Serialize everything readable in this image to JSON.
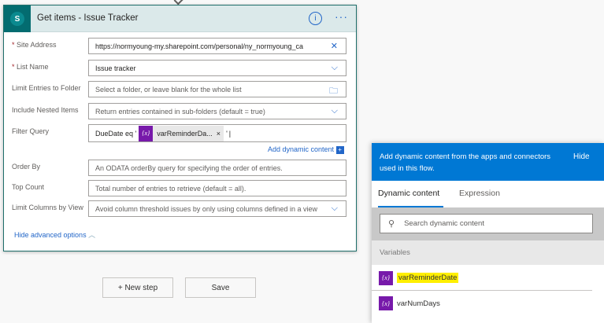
{
  "action": {
    "title": "Get items - Issue Tracker",
    "logo_letter": "S"
  },
  "fields": {
    "site_address": {
      "label": "Site Address",
      "value": "https://normyoung-my.sharepoint.com/personal/ny_normyoung_ca"
    },
    "list_name": {
      "label": "List Name",
      "value": "Issue tracker"
    },
    "folder": {
      "label": "Limit Entries to Folder",
      "placeholder": "Select a folder, or leave blank for the whole list"
    },
    "nested": {
      "label": "Include Nested Items",
      "placeholder": "Return entries contained in sub-folders (default = true)"
    },
    "filter": {
      "label": "Filter Query",
      "prefix": "DueDate eq '",
      "token": "varReminderDa...",
      "suffix": "'"
    },
    "order_by": {
      "label": "Order By",
      "placeholder": "An ODATA orderBy query for specifying the order of entries."
    },
    "top_count": {
      "label": "Top Count",
      "placeholder": "Total number of entries to retrieve (default = all)."
    },
    "limit_columns": {
      "label": "Limit Columns by View",
      "placeholder": "Avoid column threshold issues by only using columns defined in a view"
    }
  },
  "add_dynamic": "Add dynamic content",
  "hide_advanced": "Hide advanced options",
  "buttons": {
    "new_step": "+ New step",
    "save": "Save"
  },
  "panel": {
    "header": "Add dynamic content from the apps and connectors used in this flow.",
    "hide": "Hide",
    "tabs": [
      "Dynamic content",
      "Expression"
    ],
    "search_placeholder": "Search dynamic content",
    "section": "Variables",
    "items": [
      "varReminderDate",
      "varNumDays"
    ]
  },
  "colors": {
    "accent": "#0078d4",
    "sharepoint": "#036c70",
    "variable": "#7719aa",
    "highlight": "#ffef00"
  }
}
